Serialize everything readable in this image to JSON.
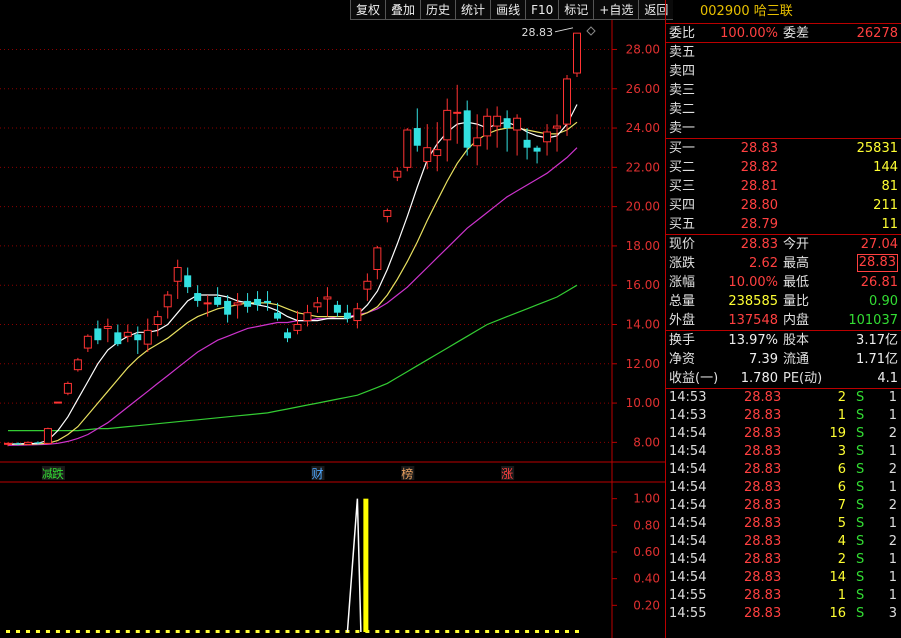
{
  "toolbar": [
    "复权",
    "叠加",
    "历史",
    "统计",
    "画线",
    "F10",
    "标记",
    "+自选",
    "返回"
  ],
  "chart_data": {
    "type": "candlestick",
    "price_axis_ticks": [
      "28.00",
      "26.00",
      "24.00",
      "22.00",
      "20.00",
      "18.00",
      "16.00",
      "14.00",
      "12.00",
      "10.00",
      "8.00"
    ],
    "ylim": [
      7.0,
      29.5
    ],
    "high_label": "28.83",
    "candles": [
      [
        7.9,
        7.95,
        7.8,
        8.0
      ],
      [
        7.95,
        7.9,
        7.85,
        8.0
      ],
      [
        7.9,
        8.0,
        7.85,
        8.05
      ],
      [
        8.0,
        7.95,
        7.9,
        8.05
      ],
      [
        7.95,
        8.7,
        7.9,
        8.75
      ],
      [
        10.05,
        10.05,
        10.05,
        10.05
      ],
      [
        10.5,
        11.0,
        10.4,
        11.1
      ],
      [
        11.7,
        12.2,
        11.6,
        12.3
      ],
      [
        12.8,
        13.4,
        12.6,
        13.5
      ],
      [
        13.8,
        13.2,
        13.0,
        14.2
      ],
      [
        13.8,
        13.9,
        13.1,
        14.3
      ],
      [
        13.6,
        13.0,
        12.9,
        14.0
      ],
      [
        13.4,
        13.6,
        13.1,
        14.0
      ],
      [
        13.5,
        13.2,
        12.5,
        13.9
      ],
      [
        13.0,
        13.7,
        12.6,
        14.3
      ],
      [
        14.0,
        14.4,
        13.4,
        14.7
      ],
      [
        14.9,
        15.5,
        14.3,
        15.7
      ],
      [
        16.2,
        16.9,
        15.3,
        17.3
      ],
      [
        16.5,
        15.9,
        15.6,
        16.9
      ],
      [
        15.6,
        15.2,
        14.9,
        16.0
      ],
      [
        15.1,
        15.1,
        14.4,
        15.5
      ],
      [
        15.4,
        15.0,
        14.9,
        15.9
      ],
      [
        15.2,
        14.5,
        14.1,
        15.5
      ],
      [
        15.0,
        15.1,
        14.3,
        15.6
      ],
      [
        15.2,
        14.9,
        14.6,
        15.6
      ],
      [
        15.3,
        15.0,
        14.7,
        15.7
      ],
      [
        15.2,
        15.1,
        14.7,
        15.7
      ],
      [
        14.6,
        14.3,
        14.2,
        15.1
      ],
      [
        13.6,
        13.3,
        13.1,
        13.8
      ],
      [
        13.7,
        14.0,
        13.5,
        14.7
      ],
      [
        14.2,
        14.6,
        13.9,
        15.0
      ],
      [
        14.9,
        15.1,
        14.6,
        15.4
      ],
      [
        15.3,
        15.4,
        14.4,
        15.9
      ],
      [
        15.0,
        14.6,
        14.4,
        15.2
      ],
      [
        14.6,
        14.3,
        14.1,
        15.0
      ],
      [
        14.2,
        14.8,
        13.8,
        15.1
      ],
      [
        15.8,
        16.2,
        15.2,
        16.6
      ],
      [
        16.8,
        17.9,
        16.3,
        18.0
      ],
      [
        19.5,
        19.8,
        19.2,
        19.9
      ],
      [
        21.5,
        21.8,
        21.3,
        22.0
      ],
      [
        22.0,
        23.9,
        21.8,
        24.0
      ],
      [
        24.0,
        23.1,
        22.8,
        25.0
      ],
      [
        22.3,
        23.0,
        21.9,
        24.2
      ],
      [
        22.6,
        22.9,
        21.8,
        24.3
      ],
      [
        23.4,
        24.9,
        22.3,
        25.5
      ],
      [
        24.8,
        24.8,
        23.2,
        26.2
      ],
      [
        24.9,
        23.0,
        22.6,
        25.4
      ],
      [
        23.1,
        23.5,
        22.1,
        24.7
      ],
      [
        23.6,
        24.6,
        22.9,
        25.0
      ],
      [
        24.1,
        24.6,
        23.0,
        25.1
      ],
      [
        24.5,
        24.0,
        22.8,
        24.9
      ],
      [
        23.9,
        24.5,
        22.6,
        24.7
      ],
      [
        23.4,
        23.0,
        22.4,
        24.0
      ],
      [
        23.0,
        22.8,
        22.2,
        23.1
      ],
      [
        23.3,
        23.8,
        22.6,
        24.2
      ],
      [
        24.0,
        24.1,
        22.8,
        24.7
      ],
      [
        24.2,
        26.5,
        23.6,
        26.7
      ],
      [
        26.8,
        28.83,
        26.6,
        28.83
      ]
    ],
    "ma_white": [
      7.9,
      7.93,
      7.93,
      7.95,
      8.1,
      8.6,
      9.3,
      10.2,
      11.1,
      12.0,
      12.7,
      13.1,
      13.4,
      13.6,
      13.6,
      13.7,
      14.0,
      14.6,
      15.2,
      15.5,
      15.5,
      15.5,
      15.4,
      15.2,
      15.1,
      15.0,
      14.9,
      14.7,
      14.4,
      14.2,
      14.2,
      14.2,
      14.3,
      14.3,
      14.3,
      14.5,
      15.0,
      15.7,
      16.8,
      18.1,
      19.5,
      21.0,
      22.4,
      23.2,
      23.8,
      24.2,
      24.3,
      24.2,
      24.0,
      24.2,
      24.3,
      24.1,
      23.8,
      23.6,
      23.5,
      23.6,
      24.2,
      25.2
    ],
    "ma_yellow": [
      7.9,
      7.9,
      7.9,
      7.92,
      7.95,
      8.1,
      8.4,
      8.8,
      9.4,
      10.0,
      10.6,
      11.2,
      11.8,
      12.3,
      12.7,
      13.0,
      13.3,
      13.7,
      14.1,
      14.4,
      14.6,
      14.8,
      14.9,
      15.0,
      15.1,
      15.1,
      15.1,
      15.0,
      14.8,
      14.6,
      14.5,
      14.4,
      14.4,
      14.4,
      14.4,
      14.4,
      14.6,
      14.9,
      15.5,
      16.3,
      17.2,
      18.2,
      19.3,
      20.3,
      21.3,
      22.2,
      22.9,
      23.4,
      23.7,
      23.9,
      24.0,
      24.0,
      23.9,
      23.8,
      23.7,
      23.7,
      23.9,
      24.3
    ],
    "ma_purple": [
      7.85,
      7.86,
      7.87,
      7.88,
      7.9,
      7.95,
      8.05,
      8.2,
      8.4,
      8.7,
      9.0,
      9.4,
      9.8,
      10.2,
      10.6,
      11.0,
      11.4,
      11.8,
      12.2,
      12.6,
      12.9,
      13.2,
      13.4,
      13.6,
      13.8,
      13.9,
      14.0,
      14.1,
      14.1,
      14.2,
      14.2,
      14.3,
      14.3,
      14.4,
      14.4,
      14.5,
      14.6,
      14.8,
      15.1,
      15.5,
      15.9,
      16.4,
      16.9,
      17.4,
      17.9,
      18.4,
      18.9,
      19.3,
      19.7,
      20.1,
      20.5,
      20.8,
      21.1,
      21.4,
      21.7,
      22.1,
      22.5,
      23.0
    ],
    "ma_green": [
      8.6,
      8.6,
      8.6,
      8.6,
      8.6,
      8.6,
      8.6,
      8.6,
      8.65,
      8.7,
      8.7,
      8.75,
      8.8,
      8.85,
      8.9,
      8.95,
      9.0,
      9.05,
      9.1,
      9.15,
      9.2,
      9.25,
      9.3,
      9.35,
      9.4,
      9.45,
      9.5,
      9.6,
      9.7,
      9.8,
      9.9,
      10.0,
      10.1,
      10.2,
      10.3,
      10.4,
      10.6,
      10.8,
      11.0,
      11.3,
      11.6,
      11.9,
      12.2,
      12.5,
      12.8,
      13.1,
      13.4,
      13.7,
      14.0,
      14.2,
      14.4,
      14.6,
      14.8,
      15.0,
      15.2,
      15.4,
      15.7,
      16.0
    ],
    "events": [
      {
        "label": "减",
        "idx": 4,
        "color": "#33dd33"
      },
      {
        "label": "跌",
        "idx": 5,
        "color": "#33dd33"
      },
      {
        "label": "财",
        "idx": 31,
        "color": "#4fa8ff"
      },
      {
        "label": "榜",
        "idx": 40,
        "color": "#e8a060"
      },
      {
        "label": "涨",
        "idx": 50,
        "color": "#ff4040"
      }
    ],
    "indicator_ticks": [
      "1.00",
      "0.80",
      "0.60",
      "0.40",
      "0.20"
    ],
    "indicator_ylim": [
      0,
      1.05
    ],
    "indicator_signal_idx": 35,
    "indicator_bar_idx": 36
  },
  "panel": {
    "code": "002900",
    "name": "哈三联",
    "weibi_label": "委比",
    "weibi_value": "100.00%",
    "weicha_label": "委差",
    "weicha_value": "26278",
    "asks": [
      {
        "label": "卖五"
      },
      {
        "label": "卖四"
      },
      {
        "label": "卖三"
      },
      {
        "label": "卖二"
      },
      {
        "label": "卖一"
      }
    ],
    "bids": [
      {
        "label": "买一",
        "price": "28.83",
        "vol": "25831"
      },
      {
        "label": "买二",
        "price": "28.82",
        "vol": "144"
      },
      {
        "label": "买三",
        "price": "28.81",
        "vol": "81"
      },
      {
        "label": "买四",
        "price": "28.80",
        "vol": "211"
      },
      {
        "label": "买五",
        "price": "28.79",
        "vol": "11"
      }
    ],
    "stats": [
      {
        "l1": "现价",
        "v1": "28.83",
        "c1": "red",
        "l2": "今开",
        "v2": "27.04",
        "c2": "red"
      },
      {
        "l1": "涨跌",
        "v1": "2.62",
        "c1": "red",
        "l2": "最高",
        "v2": "28.83",
        "c2": "red",
        "boxed": true
      },
      {
        "l1": "涨幅",
        "v1": "10.00%",
        "c1": "red",
        "l2": "最低",
        "v2": "26.81",
        "c2": "red"
      },
      {
        "l1": "总量",
        "v1": "238585",
        "c1": "yellow",
        "l2": "量比",
        "v2": "0.90",
        "c2": "green"
      },
      {
        "l1": "外盘",
        "v1": "137548",
        "c1": "red",
        "l2": "内盘",
        "v2": "101037",
        "c2": "green"
      }
    ],
    "stats2": [
      {
        "l1": "换手",
        "v1": "13.97%",
        "c1": "white",
        "l2": "股本",
        "v2": "3.17亿",
        "c2": "white"
      },
      {
        "l1": "净资",
        "v1": "7.39",
        "c1": "white",
        "l2": "流通",
        "v2": "1.71亿",
        "c2": "white"
      },
      {
        "l1": "收益(一)",
        "v1": "1.780",
        "c1": "white",
        "l2": "PE(动)",
        "v2": "4.1",
        "c2": "white"
      }
    ],
    "ticks": [
      {
        "time": "14:53",
        "price": "28.83",
        "vol": "2",
        "side": "S",
        "n": "1"
      },
      {
        "time": "14:53",
        "price": "28.83",
        "vol": "1",
        "side": "S",
        "n": "1"
      },
      {
        "time": "14:54",
        "price": "28.83",
        "vol": "19",
        "side": "S",
        "n": "2"
      },
      {
        "time": "14:54",
        "price": "28.83",
        "vol": "3",
        "side": "S",
        "n": "1"
      },
      {
        "time": "14:54",
        "price": "28.83",
        "vol": "6",
        "side": "S",
        "n": "2"
      },
      {
        "time": "14:54",
        "price": "28.83",
        "vol": "6",
        "side": "S",
        "n": "1"
      },
      {
        "time": "14:54",
        "price": "28.83",
        "vol": "7",
        "side": "S",
        "n": "2"
      },
      {
        "time": "14:54",
        "price": "28.83",
        "vol": "5",
        "side": "S",
        "n": "1"
      },
      {
        "time": "14:54",
        "price": "28.83",
        "vol": "4",
        "side": "S",
        "n": "2"
      },
      {
        "time": "14:54",
        "price": "28.83",
        "vol": "2",
        "side": "S",
        "n": "1"
      },
      {
        "time": "14:54",
        "price": "28.83",
        "vol": "14",
        "side": "S",
        "n": "1"
      },
      {
        "time": "14:55",
        "price": "28.83",
        "vol": "1",
        "side": "S",
        "n": "1"
      },
      {
        "time": "14:55",
        "price": "28.83",
        "vol": "16",
        "side": "S",
        "n": "3"
      }
    ]
  }
}
